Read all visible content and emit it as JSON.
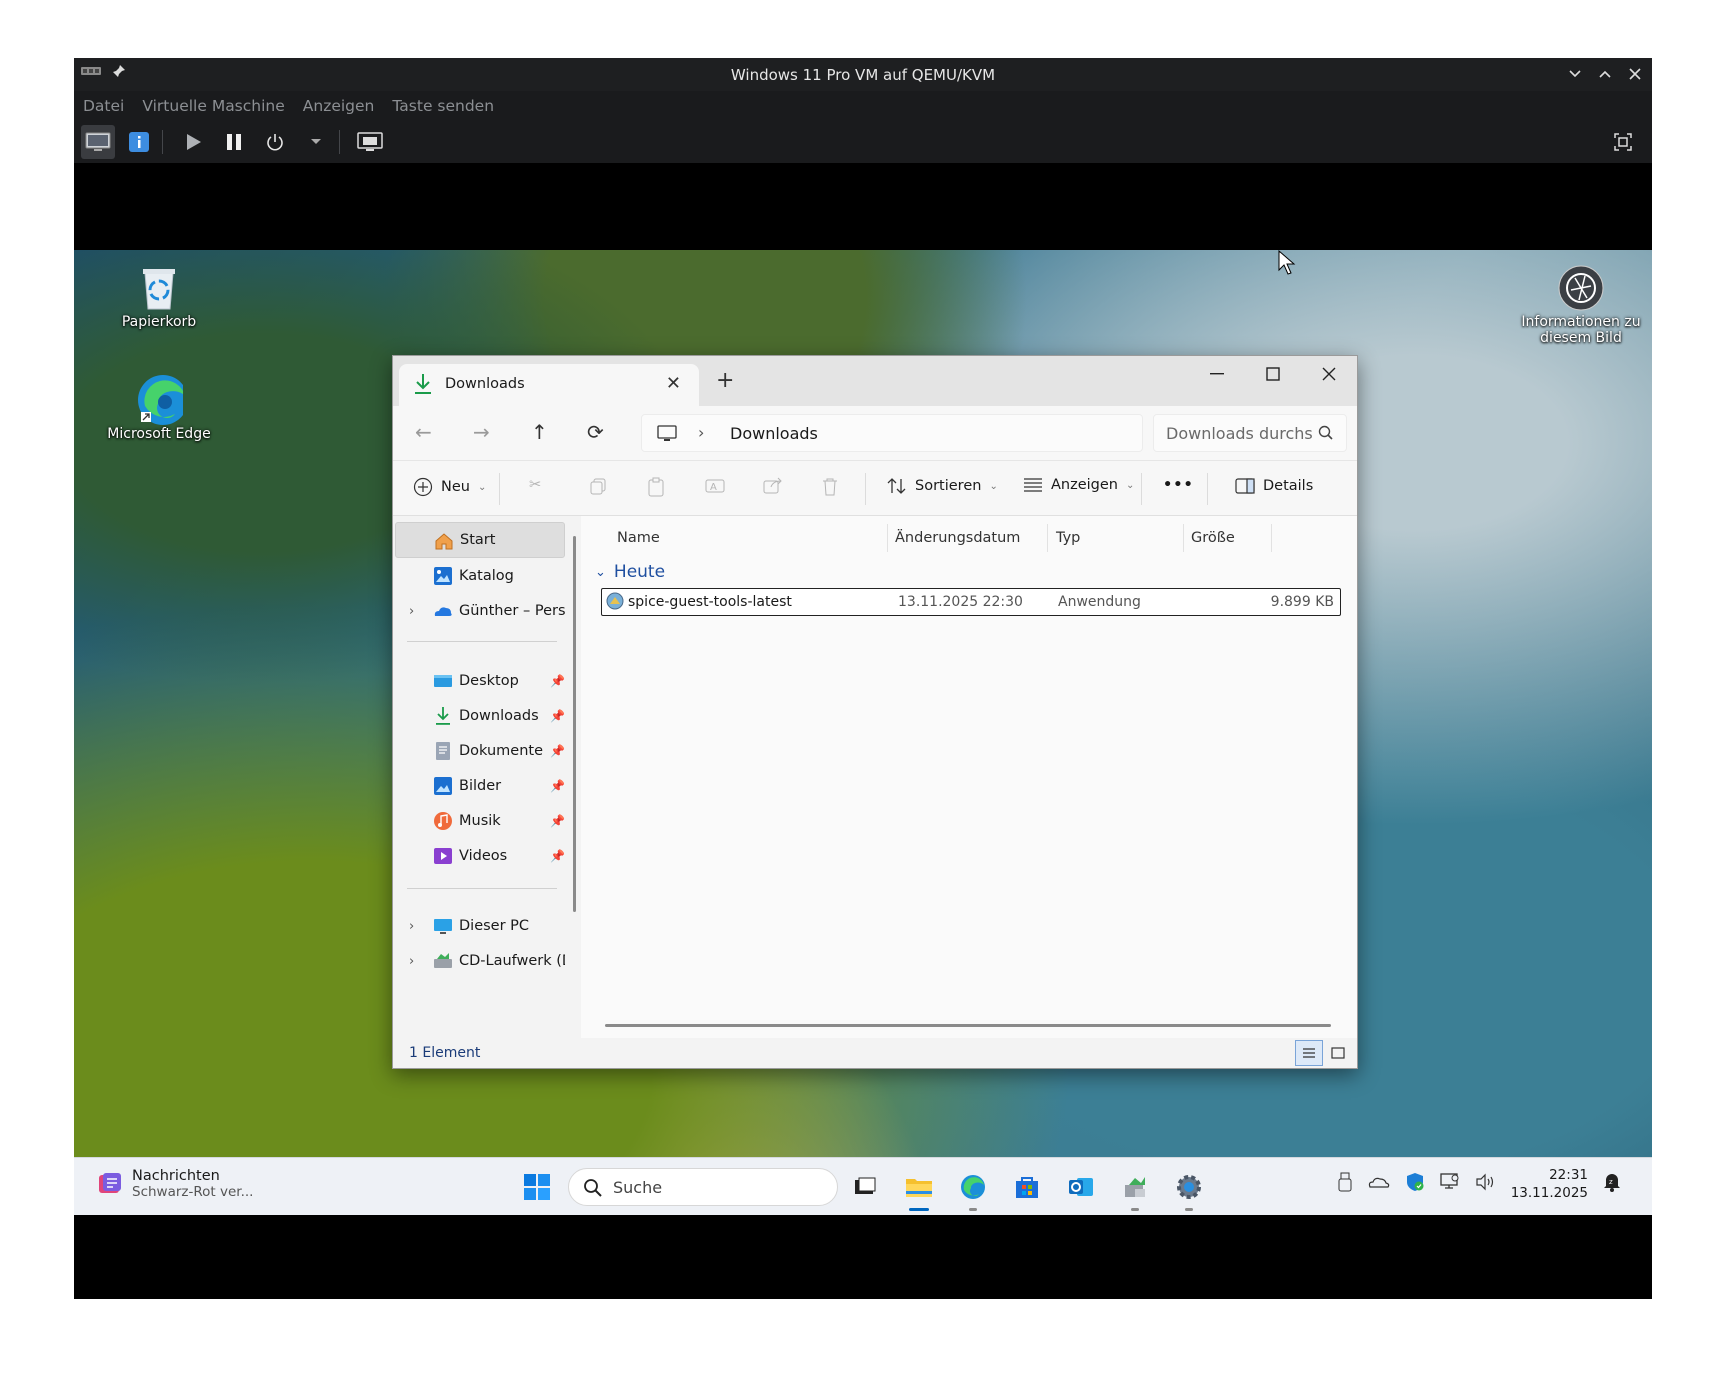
{
  "vm": {
    "title": "Windows 11 Pro VM auf QEMU/KVM",
    "menu": [
      "Datei",
      "Virtuelle Maschine",
      "Anzeigen",
      "Taste senden"
    ]
  },
  "desktop": {
    "icons": [
      {
        "label": "Papierkorb",
        "icon": "recycle-bin-icon"
      },
      {
        "label": "Microsoft Edge",
        "icon": "edge-icon"
      },
      {
        "label": "Informationen zu diesem Bild",
        "icon": "camera-icon"
      }
    ]
  },
  "explorer": {
    "tab_label": "Downloads",
    "address": "Downloads",
    "search_placeholder": "Downloads durchsuchen",
    "commands": {
      "new": "Neu",
      "sort": "Sortieren",
      "view": "Anzeigen",
      "more": "•••",
      "details": "Details"
    },
    "nav": {
      "items": [
        {
          "label": "Start",
          "icon": "home-icon"
        },
        {
          "label": "Katalog",
          "icon": "gallery-icon"
        },
        {
          "label": "Günther – Persönlich",
          "icon": "onedrive-icon"
        },
        {
          "label": "Desktop",
          "icon": "desktop-icon"
        },
        {
          "label": "Downloads",
          "icon": "download-icon"
        },
        {
          "label": "Dokumente",
          "icon": "documents-icon"
        },
        {
          "label": "Bilder",
          "icon": "pictures-icon"
        },
        {
          "label": "Musik",
          "icon": "music-icon"
        },
        {
          "label": "Videos",
          "icon": "videos-icon"
        },
        {
          "label": "Dieser PC",
          "icon": "this-pc-icon"
        },
        {
          "label": "CD-Laufwerk (D",
          "icon": "cd-drive-icon"
        }
      ]
    },
    "columns": [
      "Name",
      "Änderungsdatum",
      "Typ",
      "Größe"
    ],
    "group": "Heute",
    "files": [
      {
        "name": "spice-guest-tools-latest",
        "date": "13.11.2025 22:30",
        "type": "Anwendung",
        "size": "9.899 KB"
      }
    ],
    "status": "1 Element"
  },
  "taskbar": {
    "news_title": "Nachrichten",
    "news_sub": "Schwarz-Rot ver...",
    "search_placeholder": "Suche",
    "time": "22:31",
    "date": "13.11.2025"
  },
  "colors": {
    "accent": "#0067c0",
    "vm_chrome": "#1e1f21",
    "explorer_bg": "#f3f3f3"
  }
}
